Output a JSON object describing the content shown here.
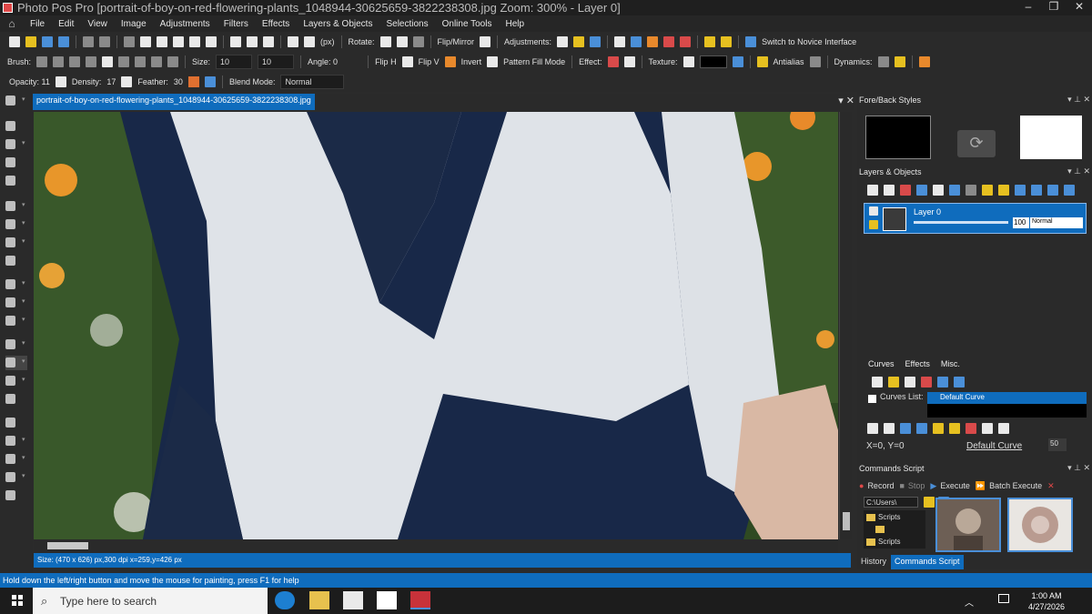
{
  "window": {
    "title": "Photo Pos Pro [portrait-of-boy-on-red-flowering-plants_1048944-30625659-3822238308.jpg  Zoom: 300% - Layer 0]",
    "controls": [
      "–",
      "❐",
      "✕"
    ]
  },
  "menu": {
    "items": [
      "File",
      "Edit",
      "View",
      "Image",
      "Adjustments",
      "Filters",
      "Effects",
      "Layers & Objects",
      "Selections",
      "Online Tools",
      "Help"
    ]
  },
  "toolbar1": {
    "units": "(px)",
    "rotate_label": "Rotate:",
    "flip_mirror_label": "Flip/Mirror",
    "adjustments_label": "Adjustments:",
    "novice_label": "Switch to Novice Interface"
  },
  "toolbar2": {
    "brush_label": "Brush:",
    "size_label": "Size:",
    "size_value_1": "10",
    "size_value_2": "10",
    "angle_label": "Angle: 0",
    "flip_h": "Flip H",
    "flip_v": "Flip V",
    "invert": "Invert",
    "pattern_fill": "Pattern Fill Mode",
    "effect_label": "Effect:",
    "texture_label": "Texture:",
    "antialias_label": "Antialias",
    "dynamics_label": "Dynamics:"
  },
  "toolbar3": {
    "opacity_label": "Opacity: 11",
    "density_label": "Density:",
    "density_value": "17",
    "feather_label": "Feather:",
    "feather_value": "30",
    "blend_label": "Blend Mode:",
    "blend_value": "Normal"
  },
  "document": {
    "tab_name": "portrait-of-boy-on-red-flowering-plants_1048944-30625659-3822238308.jpg",
    "status": "Size: (470 x 626) px,300 dpi   x=259,y=426 px"
  },
  "panels": {
    "fore_back_title": "Fore/Back Styles",
    "layers_title": "Layers & Objects",
    "layer_name": "Layer 0",
    "layer_opacity": "100",
    "layer_mode": "Normal",
    "curves_tab": "Curves",
    "effects_tab": "Effects",
    "misc_tab": "Misc.",
    "curves_list_label": "Curves List:",
    "default_curve": "Default Curve",
    "xy_readout": "X=0, Y=0",
    "curve_link": "Default Curve",
    "curve_value": "50",
    "commands_title": "Commands Script",
    "record": "Record",
    "stop": "Stop",
    "execute": "Execute",
    "batch_execute": "Batch Execute",
    "path": "C:\\Users\\",
    "folders": [
      "Scripts",
      "",
      "Scripts"
    ],
    "history_tab": "History",
    "commands_tab": "Commands Script"
  },
  "statusbar": {
    "hint": "Hold down the left/right button and move the mouse for painting, press F1 for help"
  },
  "taskbar": {
    "search_placeholder": "Type here to search",
    "time": "1:00 AM",
    "date": "4/27/2026"
  },
  "colors": {
    "accent": "#0f6cbd",
    "panel_bg": "#2a2a2a",
    "shirt_white": "#dfe3e8",
    "sweater_navy": "#1b2a47"
  }
}
